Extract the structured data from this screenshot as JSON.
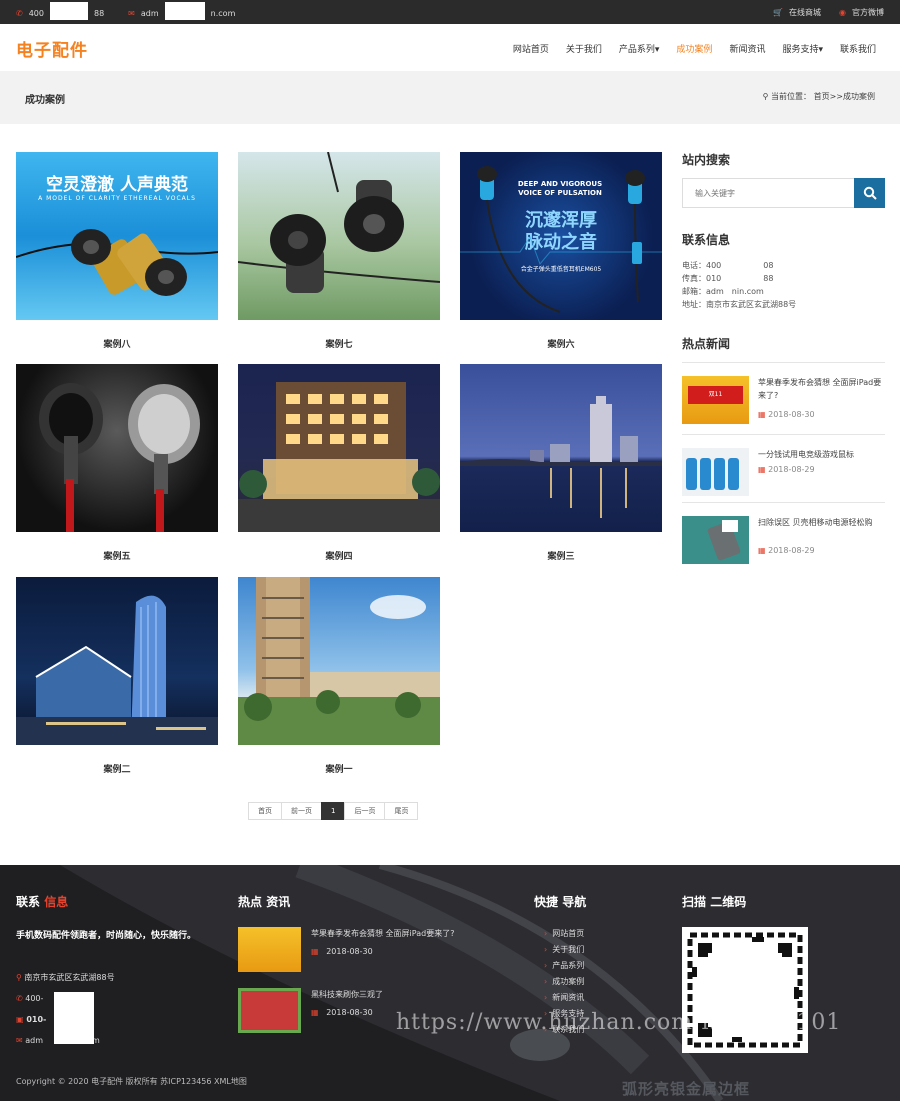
{
  "topbar": {
    "phone_prefix": "400",
    "phone_suffix": "88",
    "email_prefix": "adm",
    "email_suffix": "n.com",
    "shop": "在线商城",
    "weibo": "官方微博"
  },
  "header": {
    "logo": "电子配件",
    "nav": [
      "网站首页",
      "关于我们",
      "产品系列▾",
      "成功案例",
      "新闻资讯",
      "服务支持▾",
      "联系我们"
    ]
  },
  "crumb": {
    "title": "成功案例",
    "location": "当前位置： 首页>>成功案例"
  },
  "cases": [
    {
      "label": "案例八",
      "banner": "空灵澄澈  人声典范",
      "sub": "A MODEL OF CLARITY ETHEREAL VOCALS"
    },
    {
      "label": "案例七"
    },
    {
      "label": "案例六",
      "banner_en1": "DEEP AND VIGOROUS",
      "banner_en2": "VOICE OF PULSATION",
      "banner_cn1": "沉邃浑厚",
      "banner_cn2": "脉动之音",
      "banner_small": "合金子弹头重低音耳机EM605"
    },
    {
      "label": "案例五"
    },
    {
      "label": "案例四"
    },
    {
      "label": "案例三"
    },
    {
      "label": "案例二"
    },
    {
      "label": "案例一"
    }
  ],
  "pager": {
    "first": "首页",
    "prev": "前一页",
    "current": "1",
    "next": "后一页",
    "last": "尾页"
  },
  "sidebar": {
    "search_title": "站内搜索",
    "search_placeholder": "输入关键字",
    "contact_title": "联系信息",
    "contact": [
      "电话：400",
      "传真：010",
      "邮箱：adm",
      "地址：南京市玄武区玄武湖88号"
    ],
    "contact_tail": [
      "08",
      "88",
      "nin.com",
      ""
    ],
    "news_title": "热点新闻",
    "news": [
      {
        "title": "苹果春季发布会猜想 全面屏iPad要来了?",
        "date": "2018-08-30"
      },
      {
        "title": "一分钱试用电竞级游戏鼠标",
        "date": "2018-08-29"
      },
      {
        "title": "扫除误区 贝壳相移动电源轻松购",
        "date": "2018-08-29"
      }
    ]
  },
  "footer": {
    "contact_h1": "联系",
    "contact_h2": "信息",
    "slogan": "手机数码配件领跑者，时尚随心，快乐随行。",
    "address": "南京市玄武区玄武湖88号",
    "phone": "400-",
    "fax": "010-",
    "fax_tail": "8",
    "email": "adm",
    "email_tail": "n.com",
    "news_h1": "热点",
    "news_h2": "资讯",
    "news": [
      {
        "title": "苹果春季发布会猜想 全面屏iPad要来了?",
        "date": "2018-08-30"
      },
      {
        "title": "黑科技来刷你三观了",
        "date": "2018-08-30"
      }
    ],
    "nav_h1": "快捷",
    "nav_h2": "导航",
    "nav": [
      "网站首页",
      "关于我们",
      "产品系列",
      "成功案例",
      "新闻资讯",
      "服务支持",
      "联系我们"
    ],
    "qr_h1": "扫描",
    "qr_h2": "二维码",
    "copyright": "Copyright © 2020 电子配件 版权所有 苏ICP123456 XML地图",
    "watermark": "https://www.huzhan.com/ishop34101",
    "bottom_text": "弧形亮银金属边框"
  }
}
